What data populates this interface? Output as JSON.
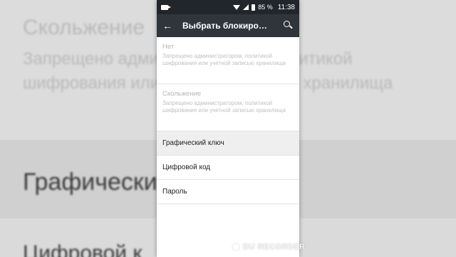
{
  "background": {
    "heading_none_blur": "Скольжение",
    "sub_blur": "Запрещено администратором, политикой шифрования или учетной записью хранилища",
    "pattern_blur": "Графический",
    "pin_blur": "Цифровой к"
  },
  "status_bar": {
    "battery": "85 %",
    "time": "11:38"
  },
  "app_bar": {
    "title": "Выбрать блокиро…"
  },
  "list": {
    "items": [
      {
        "title": "Нет",
        "subtitle": "Запрещено администратором, политикой шифрования или учетной записью хранилища"
      },
      {
        "title": "Скольжение",
        "subtitle": "Запрещено администратором, политикой шифрования или учетной записью хранилища"
      },
      {
        "title": "Графический ключ"
      },
      {
        "title": "Цифровой код"
      },
      {
        "title": "Пароль"
      }
    ]
  },
  "watermark": "DU RECORDER"
}
